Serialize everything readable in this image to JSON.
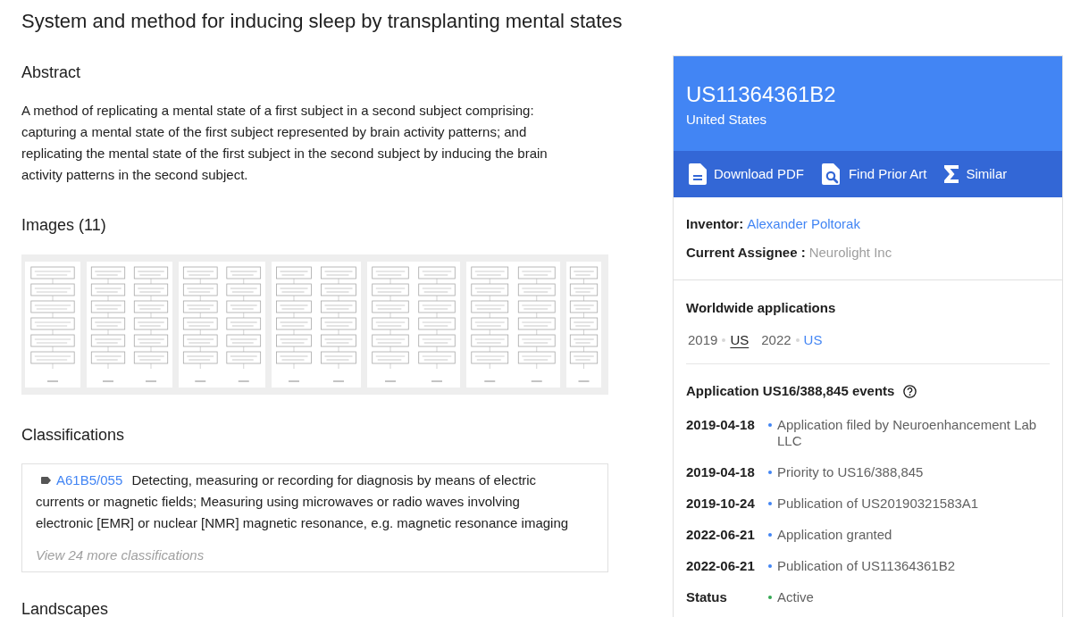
{
  "title": "System and method for inducing sleep by transplanting mental states",
  "abstract": {
    "heading": "Abstract",
    "text": "A method of replicating a mental state of a first subject in a second subject comprising: capturing a mental state of the first subject represented by brain activity patterns; and replicating the mental state of the first subject in the second subject by inducing the brain activity patterns in the second subject."
  },
  "images": {
    "heading": "Images (11)"
  },
  "classifications": {
    "heading": "Classifications",
    "items": [
      {
        "code": "A61B5/055",
        "description": "Detecting, measuring or recording for diagnosis by means of electric currents or magnetic fields; Measuring using microwaves or radio waves involving electronic [EMR] or nuclear [NMR] magnetic resonance, e.g. magnetic resonance imaging"
      }
    ],
    "more_link": "View 24 more classifications"
  },
  "landscapes": {
    "heading": "Landscapes"
  },
  "sidebar": {
    "number": "US11364361B2",
    "country": "United States",
    "actions": [
      {
        "kind": "pdf",
        "label": "Download PDF"
      },
      {
        "kind": "prior_art",
        "label": "Find Prior Art"
      },
      {
        "kind": "similar",
        "label": "Similar"
      }
    ],
    "inventor": {
      "label": "Inventor:",
      "value": "Alexander Poltorak"
    },
    "assignee": {
      "label": "Current Assignee :",
      "value": "Neurolight Inc"
    },
    "worldwide": {
      "heading": "Worldwide applications",
      "items": [
        {
          "year": "2019",
          "country": "US",
          "selected": true
        },
        {
          "year": "2022",
          "country": "US",
          "selected": false
        }
      ]
    },
    "events": {
      "heading": "Application US16/388,845 events",
      "items": [
        {
          "label": "2019-04-18",
          "text": "Application filed by Neuroenhancement Lab LLC",
          "color": "#4285f4"
        },
        {
          "label": "2019-04-18",
          "text": "Priority to US16/388,845",
          "color": "#4285f4"
        },
        {
          "label": "2019-10-24",
          "text": "Publication of US20190321583A1",
          "color": "#4285f4"
        },
        {
          "label": "2022-06-21",
          "text": "Application granted",
          "color": "#4285f4"
        },
        {
          "label": "2022-06-21",
          "text": "Publication of US11364361B2",
          "color": "#4285f4"
        },
        {
          "label": "Status",
          "text": "Active",
          "color": "#34a853"
        }
      ]
    }
  }
}
